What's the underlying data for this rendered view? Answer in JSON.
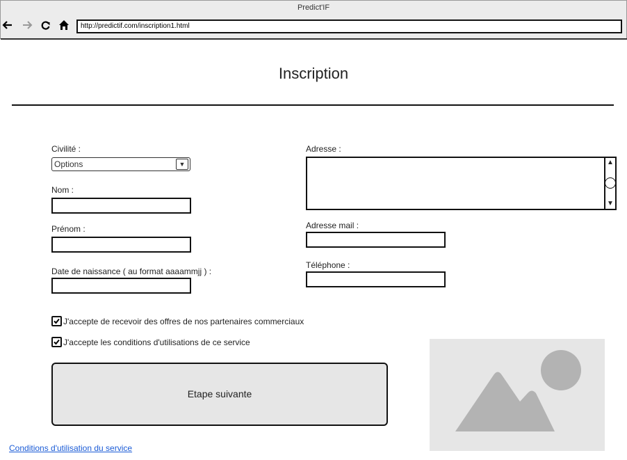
{
  "window": {
    "title": "Predict'IF"
  },
  "browser": {
    "url": "http://predictif.com/inscription1.html",
    "icons": [
      "back-arrow-icon",
      "forward-arrow-icon",
      "reload-icon",
      "home-icon"
    ]
  },
  "page": {
    "title": "Inscription"
  },
  "form": {
    "civilite_label": "Civilité :",
    "civilite_value": "Options",
    "nom_label": "Nom :",
    "prenom_label": "Prénom :",
    "naissance_label": "Date de naissance ( au format aaaammjj ) :",
    "adresse_label": "Adresse :",
    "mail_label": "Adresse mail :",
    "telephone_label": "Téléphone :",
    "check_offres": "J'accepte de recevoir des offres de nos partenaires commerciaux",
    "check_conditions": "J'accepte les conditions d'utilisations de ce service",
    "check_offres_checked": true,
    "check_conditions_checked": true,
    "next_button": "Etape suivante"
  },
  "footer": {
    "conditions_link": "Conditions d'utilisation du service"
  },
  "colors": {
    "link": "#1a5bd6",
    "placeholder": "#e6e6e6",
    "placeholder_shape": "#b3b3b3"
  }
}
